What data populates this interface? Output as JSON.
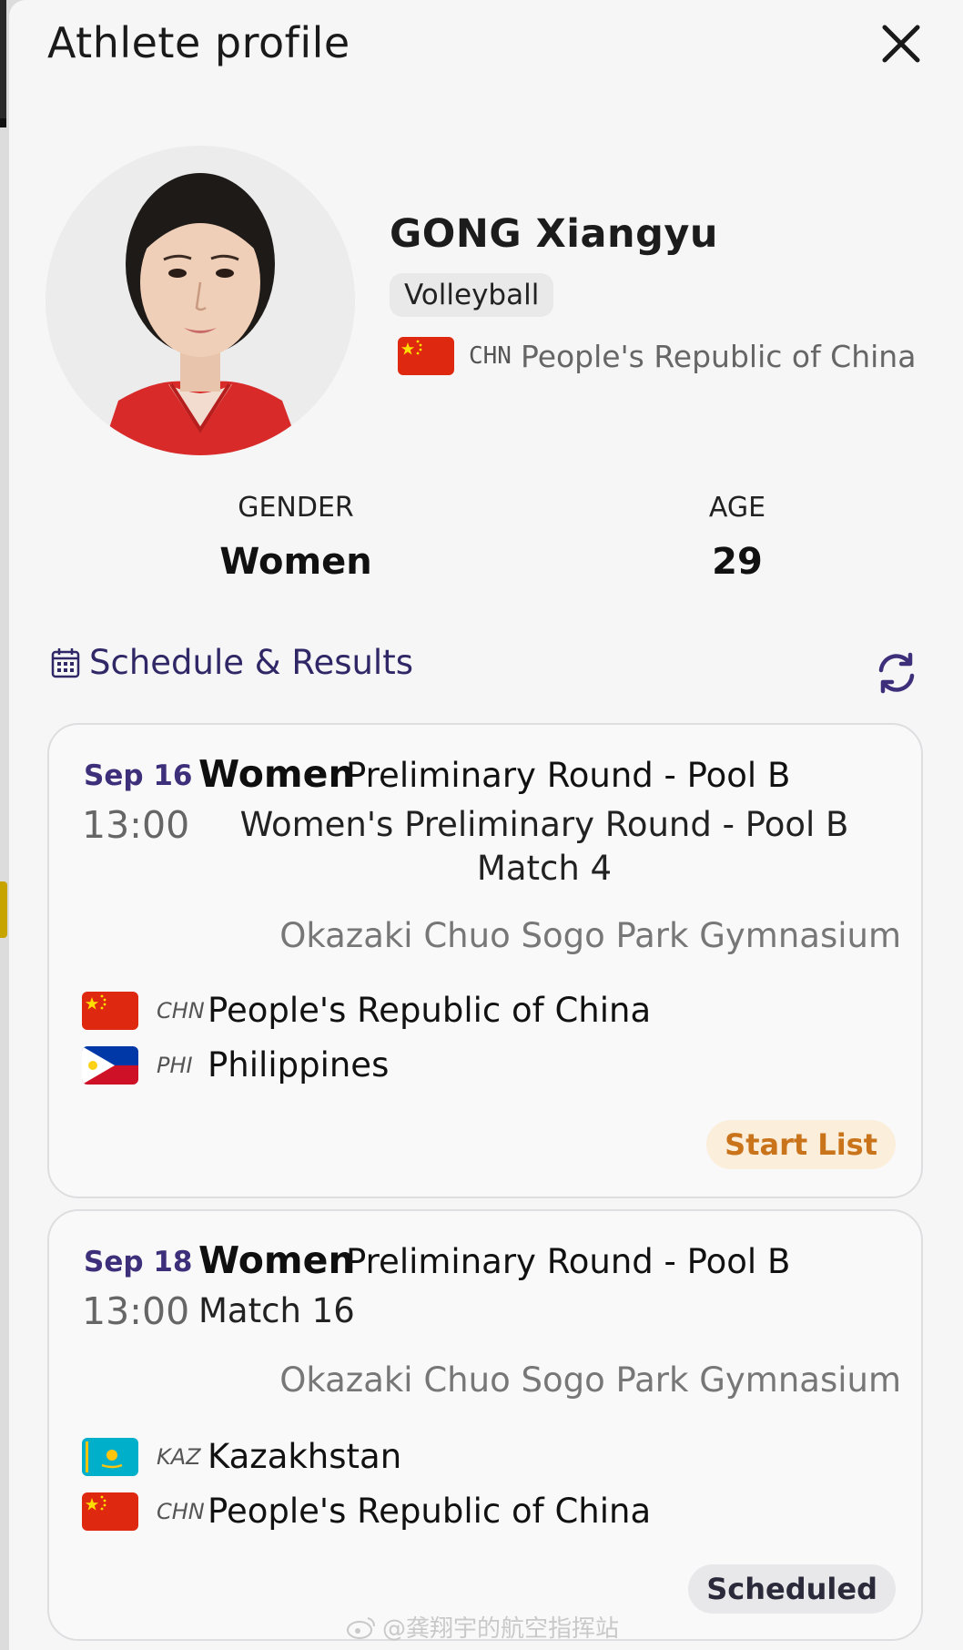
{
  "header": {
    "title": "Athlete profile"
  },
  "athlete": {
    "name": "GONG Xiangyu",
    "sport": "Volleyball",
    "country_code": "CHN",
    "country_name": "People's Republic of China"
  },
  "stats": {
    "gender_label": "GENDER",
    "gender_value": "Women",
    "age_label": "AGE",
    "age_value": "29"
  },
  "schedule": {
    "title": "Schedule & Results",
    "matches": [
      {
        "date": "Sep 16",
        "time": "13:00",
        "gender": "Women",
        "round": "Preliminary Round - Pool B",
        "event_line1": "Women's Preliminary Round - Pool B",
        "event_line2": "Match 4",
        "venue": "Okazaki Chuo Sogo Park Gymnasium",
        "teams": [
          {
            "code": "CHN",
            "name": "People's Republic of China",
            "flag": "china-flag-icon"
          },
          {
            "code": "PHI",
            "name": "Philippines",
            "flag": "philippines-flag-icon"
          }
        ],
        "status": "Start List"
      },
      {
        "date": "Sep 18",
        "time": "13:00",
        "gender": "Women",
        "round": "Preliminary Round - Pool B",
        "event_line1": "Match 16",
        "venue": "Okazaki Chuo Sogo Park Gymnasium",
        "teams": [
          {
            "code": "KAZ",
            "name": "Kazakhstan",
            "flag": "kazakhstan-flag-icon"
          },
          {
            "code": "CHN",
            "name": "People's Republic of China",
            "flag": "china-flag-icon"
          }
        ],
        "status": "Scheduled"
      }
    ]
  },
  "watermark": "@龚翔宇的航空指挥站",
  "colors": {
    "accent_purple": "#3d2f7a",
    "start_list_text": "#c9731a",
    "start_list_bg": "#fbeedb",
    "china_red": "#de2910",
    "china_yellow": "#ffde00"
  }
}
